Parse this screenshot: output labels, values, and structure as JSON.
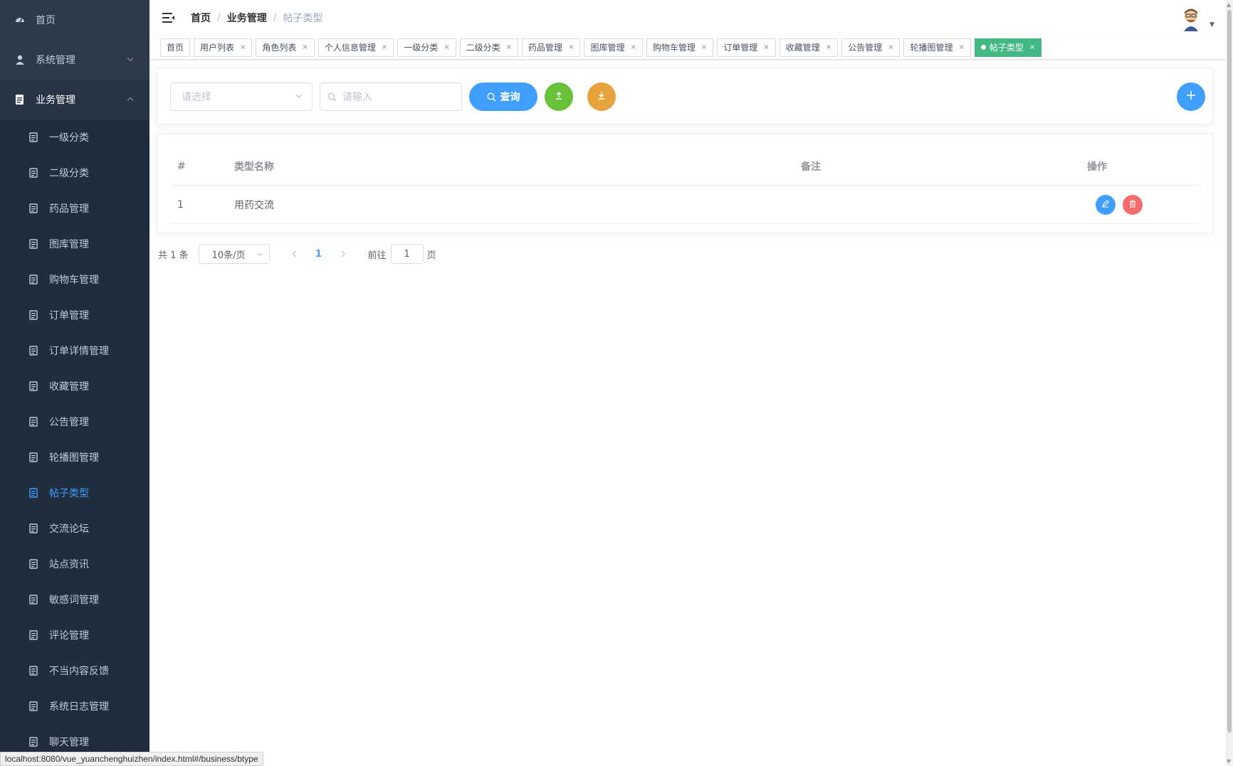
{
  "sidebar": {
    "top_items": [
      {
        "label": "首页",
        "icon": "dashboard-icon"
      },
      {
        "label": "系统管理",
        "icon": "user-icon"
      },
      {
        "label": "业务管理",
        "icon": "document-icon"
      }
    ],
    "sub_items": [
      {
        "label": "一级分类"
      },
      {
        "label": "二级分类"
      },
      {
        "label": "药品管理"
      },
      {
        "label": "图库管理"
      },
      {
        "label": "购物车管理"
      },
      {
        "label": "订单管理"
      },
      {
        "label": "订单详情管理"
      },
      {
        "label": "收藏管理"
      },
      {
        "label": "公告管理"
      },
      {
        "label": "轮播图管理"
      },
      {
        "label": "帖子类型"
      },
      {
        "label": "交流论坛"
      },
      {
        "label": "站点资讯"
      },
      {
        "label": "敏感词管理"
      },
      {
        "label": "评论管理"
      },
      {
        "label": "不当内容反馈"
      },
      {
        "label": "系统日志管理"
      },
      {
        "label": "聊天管理"
      }
    ],
    "active_sub": "帖子类型"
  },
  "breadcrumb": [
    "首页",
    "业务管理",
    "帖子类型"
  ],
  "tags": [
    {
      "label": "首页",
      "closable": false
    },
    {
      "label": "用户列表",
      "closable": true
    },
    {
      "label": "角色列表",
      "closable": true
    },
    {
      "label": "个人信息管理",
      "closable": true
    },
    {
      "label": "一级分类",
      "closable": true
    },
    {
      "label": "二级分类",
      "closable": true
    },
    {
      "label": "药品管理",
      "closable": true
    },
    {
      "label": "图库管理",
      "closable": true
    },
    {
      "label": "购物车管理",
      "closable": true
    },
    {
      "label": "订单管理",
      "closable": true
    },
    {
      "label": "收藏管理",
      "closable": true
    },
    {
      "label": "公告管理",
      "closable": true
    },
    {
      "label": "轮播图管理",
      "closable": true
    },
    {
      "label": "帖子类型",
      "closable": true,
      "active": true
    }
  ],
  "tag_close_glyph": "×",
  "search": {
    "select_placeholder": "请选择",
    "input_placeholder": "请输入",
    "query_label": "查询"
  },
  "table": {
    "headers": {
      "index": "#",
      "name": "类型名称",
      "note": "备注",
      "ops": "操作"
    },
    "rows": [
      {
        "index": "1",
        "name": "用药交流",
        "note": ""
      }
    ]
  },
  "pagination": {
    "total_text": "共 1 条",
    "page_size": "10条/页",
    "current_page": "1",
    "goto_prefix": "前往",
    "goto_value": "1",
    "goto_suffix": "页"
  },
  "status_url": "localhost:8080/vue_yuanchenghuizhen/index.html#/business/btype",
  "colors": {
    "sidebar_bg": "#2d3a4b",
    "primary": "#409eff",
    "success": "#67c23a",
    "warning": "#e6a23c",
    "danger": "#f56c6c",
    "active_tag": "#42b983"
  }
}
